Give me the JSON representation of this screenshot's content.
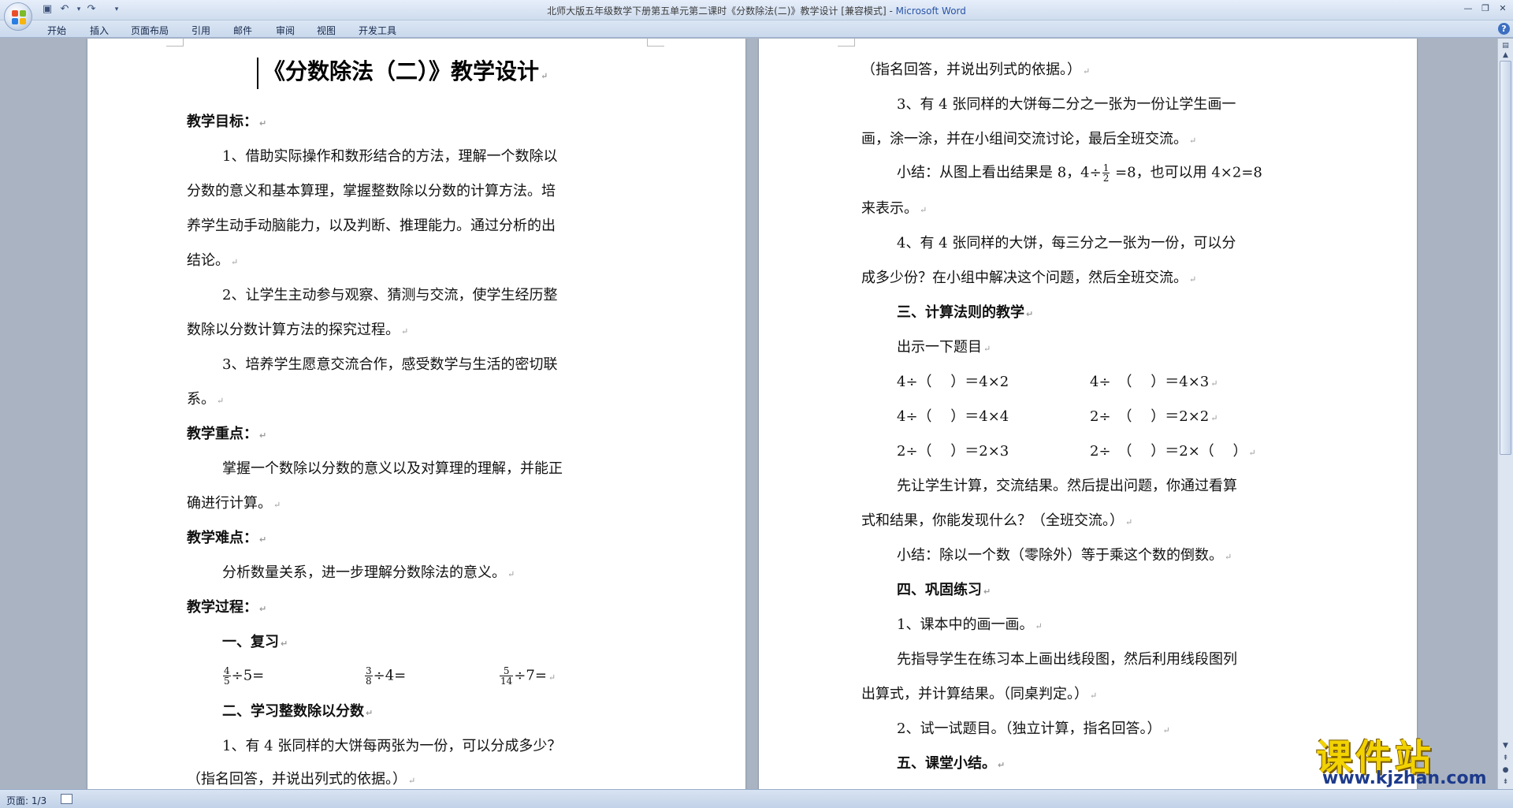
{
  "window": {
    "title": "北师大版五年级数学下册第五单元第二课时《分数除法(二)》教学设计 [兼容模式] - ",
    "app": "Microsoft Word"
  },
  "ribbon": {
    "tabs": [
      "开始",
      "插入",
      "页面布局",
      "引用",
      "邮件",
      "审阅",
      "视图",
      "开发工具"
    ]
  },
  "mark": "↵",
  "page1": {
    "title": "《分数除法（二）》教学设计",
    "l1": "教学目标：",
    "l2": "1、借助实际操作和数形结合的方法，理解一个数除以",
    "l3": "分数的意义和基本算理，掌握整数除以分数的计算方法。培",
    "l4": "养学生动手动脑能力，以及判断、推理能力。通过分析的出",
    "l5": "结论。",
    "l6": "2、让学生主动参与观察、猜测与交流，使学生经历整",
    "l7": "数除以分数计算方法的探究过程。",
    "l8": "3、培养学生愿意交流合作，感受数学与生活的密切联",
    "l9": "系。",
    "l10": "教学重点：",
    "l11": "掌握一个数除以分数的意义以及对算理的理解，并能正",
    "l12": "确进行计算。",
    "l13": "教学难点：",
    "l14": "分析数量关系，进一步理解分数除法的意义。",
    "l15": "教学过程：",
    "l16": "一、复习",
    "review": [
      {
        "num": "4",
        "den": "5",
        "rest": "÷5="
      },
      {
        "num": "3",
        "den": "8",
        "rest": "÷4="
      },
      {
        "num": "5",
        "den": "14",
        "rest": "÷7="
      }
    ],
    "l18": "二、学习整数除以分数",
    "l19": "1、有 4 张同样的大饼每两张为一份，可以分成多少？",
    "l20": "（指名回答，并说出列式的依据。）"
  },
  "page2": {
    "l1": "（指名回答，并说出列式的依据。）",
    "l2": "3、有 4 张同样的大饼每二分之一张为一份让学生画一",
    "l3": "画，涂一涂，并在小组间交流讨论，最后全班交流。",
    "l4a": "小结：从图上看出结果是 8，4÷",
    "l4num": "1",
    "l4den": "2",
    "l4b": " =8，也可以用 4×2=8",
    "l5": "来表示。",
    "l6": "4、有 4 张同样的大饼，每三分之一张为一份，可以分",
    "l7": "成多少份？在小组中解决这个问题，然后全班交流。",
    "l8": "三、计算法则的教学",
    "l9": "出示一下题目",
    "eq": [
      [
        "4÷（　 ）＝4×2",
        "4÷　（　 ）＝4×3"
      ],
      [
        "4÷（　 ）＝4×4",
        "2÷　（　 ）＝2×2"
      ],
      [
        "2÷（　 ）＝2×3",
        "2÷　（　 ）＝2×（　 ）"
      ]
    ],
    "l13": "先让学生计算，交流结果。然后提出问题，你通过看算",
    "l14": "式和结果，你能发现什么？（全班交流。）",
    "l15": "小结：除以一个数（零除外）等于乘这个数的倒数。",
    "l16": "四、巩固练习",
    "l17": "1、课本中的画一画。",
    "l18": "先指导学生在练习本上画出线段图，然后利用线段图列",
    "l19": "出算式，并计算结果。（同桌判定。）",
    "l20": "2、试一试题目。（独立计算，指名回答。）",
    "l21": "五、课堂小结。"
  },
  "status": {
    "page": "页面: 1/3"
  },
  "watermark": {
    "main": "课件站",
    "url": "www.kjzhan.com"
  },
  "colors": {
    "app_title": "#2a55a8",
    "watermark": "#f2d200",
    "watermark_url": "#1d3b8c"
  }
}
